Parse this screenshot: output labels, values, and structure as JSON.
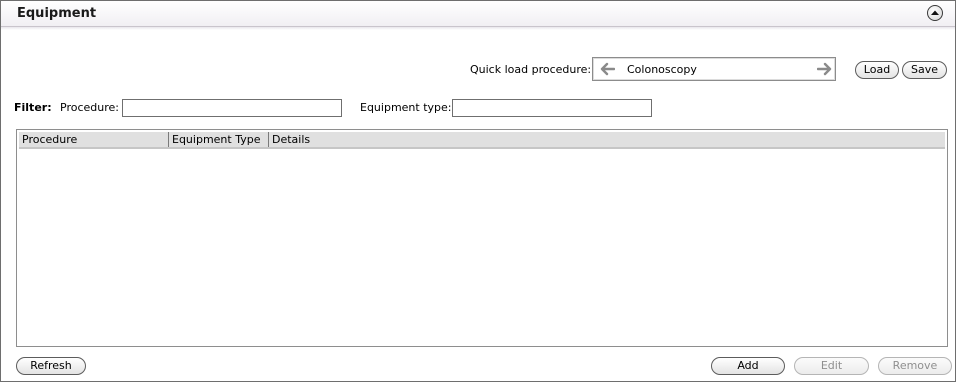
{
  "panel": {
    "title": "Equipment",
    "collapse_icon": "chevron-up-circle-icon"
  },
  "quick_load": {
    "label": "Quick load procedure:",
    "value": "Colonoscopy",
    "prev_icon": "arrow-left-icon",
    "next_icon": "arrow-right-icon",
    "load_label": "Load",
    "save_label": "Save"
  },
  "filter": {
    "label": "Filter:",
    "procedure_label": "Procedure:",
    "procedure_value": "",
    "equipment_type_label": "Equipment type:",
    "equipment_type_value": ""
  },
  "grid": {
    "columns": [
      "Procedure",
      "Equipment Type",
      "Details"
    ],
    "rows": []
  },
  "actions": {
    "refresh_label": "Refresh",
    "add_label": "Add",
    "edit_label": "Edit",
    "remove_label": "Remove",
    "edit_enabled": false,
    "remove_enabled": false
  },
  "colors": {
    "border": "#6e6e6e",
    "header_bg": "#f1eff3",
    "grid_header_bg": "#e0e0e0",
    "arrow_color": "#8a8a8a",
    "disabled_text": "#8f8f8f"
  }
}
